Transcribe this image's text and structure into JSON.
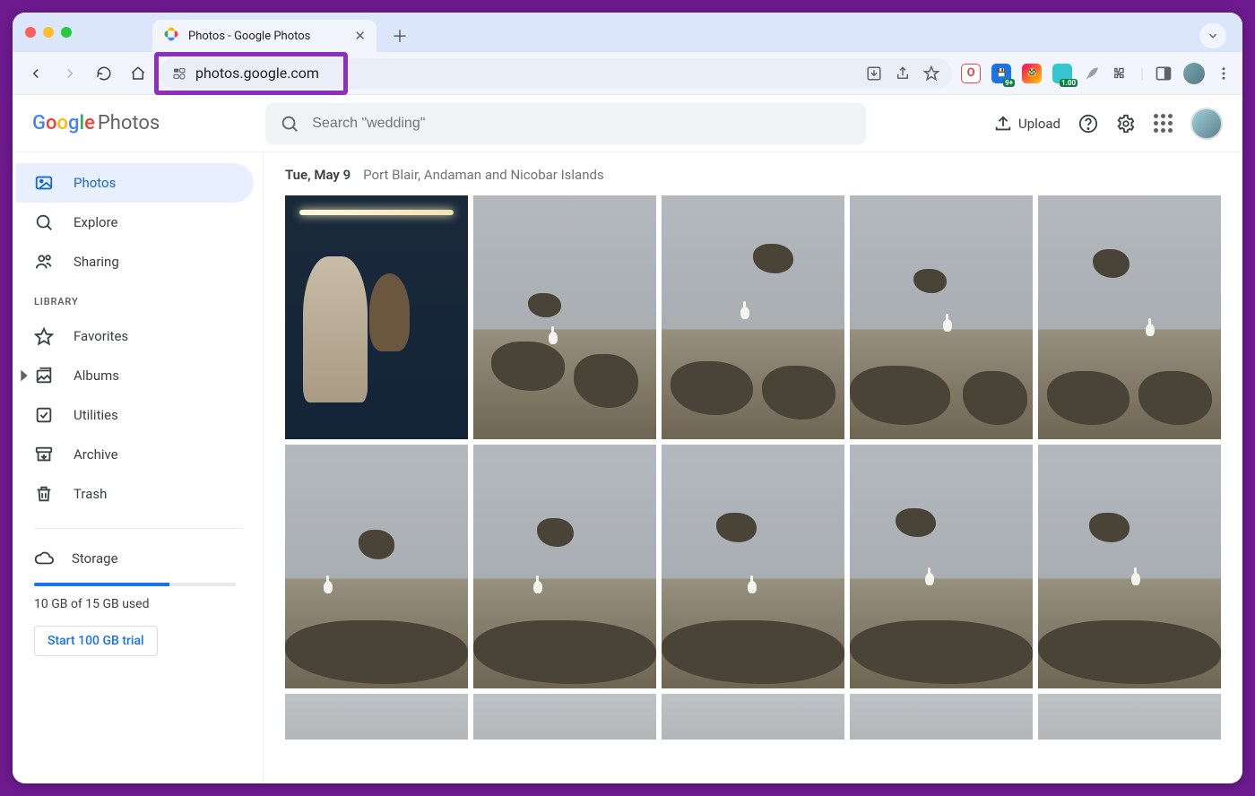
{
  "browser": {
    "tab_title": "Photos - Google Photos",
    "url": "photos.google.com",
    "ext_badge_opera": "O",
    "ext_badge_9plus": "9+",
    "ext_badge_100": "1.00"
  },
  "header": {
    "logo_product": "Photos",
    "search_placeholder": "Search \"wedding\"",
    "upload_label": "Upload"
  },
  "sidebar": {
    "nav": [
      {
        "label": "Photos",
        "key": "photos"
      },
      {
        "label": "Explore",
        "key": "explore"
      },
      {
        "label": "Sharing",
        "key": "sharing"
      }
    ],
    "section_label": "LIBRARY",
    "library": [
      {
        "label": "Favorites",
        "key": "favorites"
      },
      {
        "label": "Albums",
        "key": "albums"
      },
      {
        "label": "Utilities",
        "key": "utilities"
      },
      {
        "label": "Archive",
        "key": "archive"
      },
      {
        "label": "Trash",
        "key": "trash"
      }
    ],
    "storage_label": "Storage",
    "storage_used_text": "10 GB of 15 GB used",
    "storage_fill_percent": 67,
    "trial_button": "Start 100 GB trial"
  },
  "main": {
    "group_date": "Tue, May 9",
    "group_location": "Port Blair, Andaman and Nicobar Islands"
  }
}
